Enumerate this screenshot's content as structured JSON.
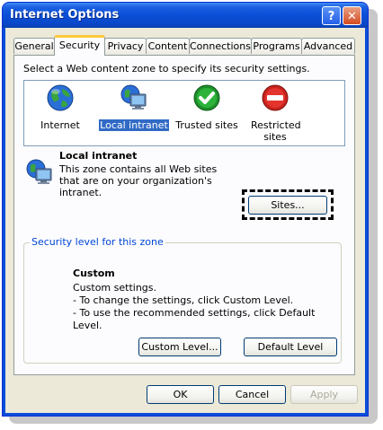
{
  "window": {
    "title": "Internet Options",
    "help_label": "?",
    "close_label": "✕"
  },
  "tabs": [
    {
      "label": "General"
    },
    {
      "label": "Security",
      "active": true
    },
    {
      "label": "Privacy"
    },
    {
      "label": "Content"
    },
    {
      "label": "Connections"
    },
    {
      "label": "Programs"
    },
    {
      "label": "Advanced"
    }
  ],
  "security": {
    "instruction": "Select a Web content zone to specify its security settings.",
    "zones": [
      {
        "label": "Internet",
        "icon": "globe-icon"
      },
      {
        "label": "Local intranet",
        "icon": "monitor-globe-icon",
        "selected": true
      },
      {
        "label": "Trusted sites",
        "icon": "green-check-icon"
      },
      {
        "label": "Restricted sites",
        "icon": "red-no-entry-icon"
      }
    ],
    "zone_info": {
      "title": "Local intranet",
      "description": "This zone contains all Web sites that are on your organization's intranet."
    },
    "sites_button": "Sites...",
    "level_group": {
      "legend": "Security level for this zone",
      "title": "Custom",
      "lines": [
        "Custom settings.",
        "- To change the settings, click Custom Level.",
        "- To use the recommended settings, click Default Level."
      ]
    },
    "custom_level_button": "Custom Level...",
    "default_level_button": "Default Level"
  },
  "footer": {
    "ok": "OK",
    "cancel": "Cancel",
    "apply": "Apply"
  },
  "colors": {
    "titlebar": "#0a4fd8",
    "selection": "#316ac5",
    "tab_highlight": "#ffc83c",
    "group_legend": "#0046d5"
  }
}
